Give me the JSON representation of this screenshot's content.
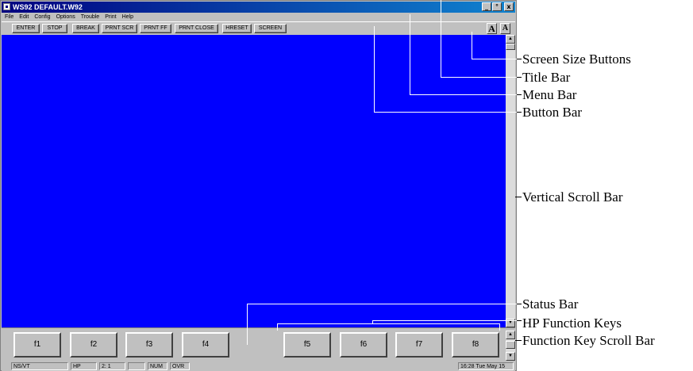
{
  "window": {
    "title": "WS92 DEFAULT.W92",
    "minimize_glyph": "_",
    "restore_glyph": "°",
    "close_glyph": "x"
  },
  "menu": [
    "File",
    "Edit",
    "Config",
    "Options",
    "Trouble",
    "Print",
    "Help"
  ],
  "buttonbar": {
    "buttons": [
      "ENTER",
      "STOP",
      "BREAK",
      "PRNT SCR",
      "PRNT FF",
      "PRNT CLOSE",
      "HRESET",
      "SCREEN"
    ],
    "size_buttons": [
      "A",
      "A"
    ]
  },
  "function_keys": [
    "f1",
    "f2",
    "f3",
    "f4",
    "f5",
    "f6",
    "f7",
    "f8"
  ],
  "statusbar": {
    "mode": "NS/VT",
    "terminal": "HP",
    "position": "2: 1",
    "blank": "",
    "num": "NUM",
    "ovr": "OVR",
    "clock": "16:28  Tue May 15"
  },
  "annotations": [
    "Screen Size Buttons",
    "Title Bar",
    "Menu Bar",
    "Button Bar",
    "Vertical Scroll Bar",
    "Status Bar",
    "HP Function Keys",
    "Function Key Scroll Bar"
  ],
  "colors": {
    "terminal_background": "#0000ff",
    "titlebar": "#000080",
    "chrome": "#c0c0c0"
  }
}
